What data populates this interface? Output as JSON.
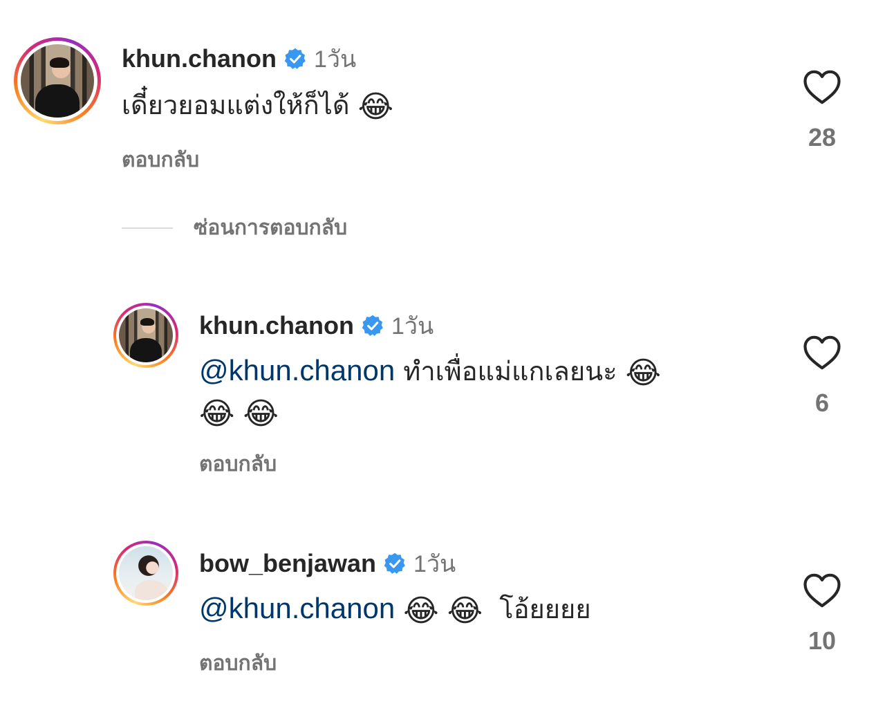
{
  "comments": [
    {
      "username": "khun.chanon",
      "time": "1วัน",
      "text": "เดี๋ยวยอมแต่งให้ก็ได้",
      "emoji": "😂",
      "reply_label": "ตอบกลับ",
      "likes": "28"
    },
    {
      "username": "khun.chanon",
      "time": "1วัน",
      "mention": "@khun.chanon",
      "text": "ทำเพื่อแม่แกเลยนะ",
      "emoji1": "😂",
      "emoji2": "😂",
      "emoji3": "😂",
      "reply_label": "ตอบกลับ",
      "likes": "6"
    },
    {
      "username": "bow_benjawan",
      "time": "1วัน",
      "mention": "@khun.chanon",
      "emoji1": "😂",
      "emoji2": "😂",
      "text": "โอ้ยยยย",
      "reply_label": "ตอบกลับ",
      "likes": "10"
    }
  ],
  "hide_replies_label": "ซ่อนการตอบกลับ",
  "colors": {
    "verified": "#3897f0",
    "mention": "#00376b",
    "secondary_text": "#737373",
    "primary_text": "#262626"
  },
  "icons": {
    "verified": "verified-badge-icon",
    "like": "heart-outline-icon"
  }
}
